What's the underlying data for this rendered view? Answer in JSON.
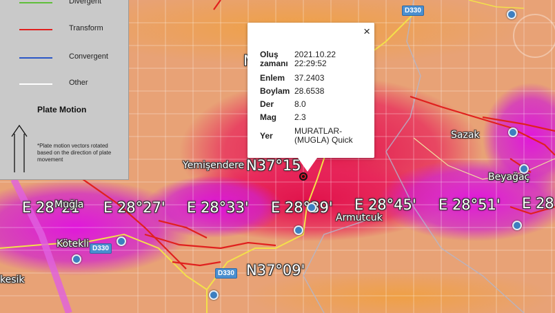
{
  "map": {
    "coords": {
      "lon_1": "E 28°21'",
      "lon_2": "E 28°27'",
      "lon_3": "E 28°33'",
      "lon_4": "E 28°39'",
      "lon_5": "E 28°45'",
      "lon_6": "E 28°51'",
      "lon_7": "E 28",
      "lat_1": "N37°15",
      "lat_2": "N37°09'",
      "lat_top": "N"
    },
    "places": {
      "mugla": "Muğla",
      "yemisendere": "Yemişendere",
      "armutcuk": "Armutcuk",
      "kotekli": "Kötekli",
      "sazak": "Sazak",
      "beyagac": "Beyağaç",
      "kesik": "kesik"
    },
    "roads": {
      "d330_a": "D330",
      "d330_b": "D330",
      "d330_c": "D330"
    },
    "icons": [
      "poi-icon",
      "epicenter-icon",
      "close-icon",
      "motion-arrow-icon"
    ]
  },
  "legend": {
    "items": [
      {
        "label": "Divergent",
        "color": "#5fbf3a"
      },
      {
        "label": "Transform",
        "color": "#e0201e"
      },
      {
        "label": "Convergent",
        "color": "#2a56c6"
      },
      {
        "label": "Other",
        "color": "#ffffff"
      }
    ],
    "motion_title": "Plate Motion",
    "motion_note": "*Plate motion vectors rotated based on the direction of plate movement"
  },
  "popup": {
    "time_label": "Oluş zamanı",
    "time_value": "2021.10.22 22:29:52",
    "lat_label": "Enlem",
    "lat_value": "37.2403",
    "lon_label": "Boylam",
    "lon_value": "28.6538",
    "depth_label": "Der",
    "depth_value": "8.0",
    "mag_label": "Mag",
    "mag_value": "2.3",
    "place_label": "Yer",
    "place_value": "MURATLAR-(MUGLA) Quick",
    "close_symbol": "×"
  }
}
